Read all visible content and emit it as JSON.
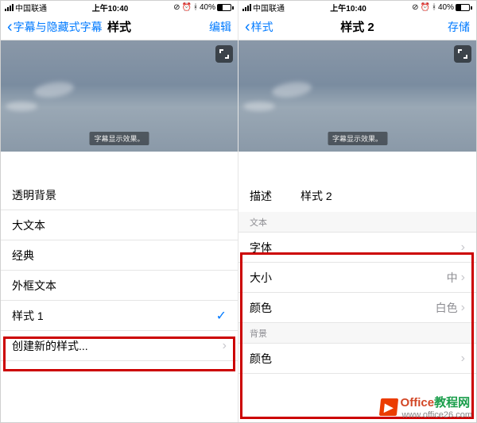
{
  "left": {
    "status": {
      "carrier": "中国联通",
      "time": "上午10:40",
      "battery_pct": "40%"
    },
    "nav": {
      "back": "字幕与隐藏式字幕",
      "title": "样式",
      "action": "编辑"
    },
    "caption_sample": "字幕显示效果。",
    "styles": [
      {
        "label": "透明背景"
      },
      {
        "label": "大文本"
      },
      {
        "label": "经典"
      },
      {
        "label": "外框文本"
      },
      {
        "label": "样式 1",
        "selected": true
      }
    ],
    "create_new": "创建新的样式..."
  },
  "right": {
    "status": {
      "carrier": "中国联通",
      "time": "上午10:40",
      "battery_pct": "40%"
    },
    "nav": {
      "back": "样式",
      "title": "样式 2",
      "action": "存储"
    },
    "caption_sample": "字幕显示效果。",
    "describe_label": "描述",
    "describe_value": "样式 2",
    "section_text": "文本",
    "rows_text": [
      {
        "label": "字体",
        "value": ""
      },
      {
        "label": "大小",
        "value": "中"
      },
      {
        "label": "颜色",
        "value": "白色"
      }
    ],
    "section_bg": "背景",
    "rows_bg": [
      {
        "label": "颜色",
        "value": ""
      }
    ]
  },
  "watermark": {
    "brand1": "Office",
    "brand2": "教程网",
    "url": "www.office26.com"
  }
}
